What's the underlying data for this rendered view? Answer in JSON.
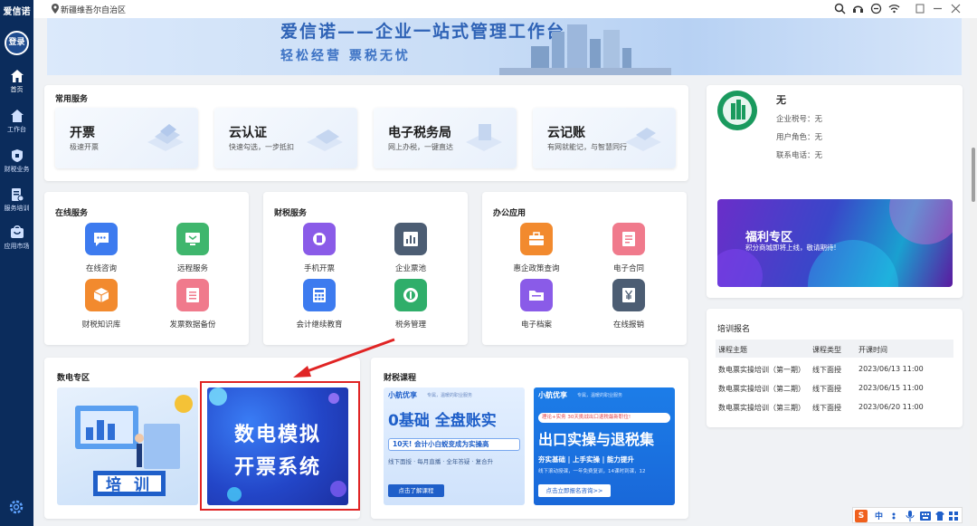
{
  "sidebar": {
    "brand": "爱信诺",
    "login": "登录",
    "items": [
      {
        "label": "首页",
        "icon": "home-icon"
      },
      {
        "label": "工作台",
        "icon": "workbench-icon"
      },
      {
        "label": "财税业务",
        "icon": "tax-business-icon"
      },
      {
        "label": "服务培训",
        "icon": "service-training-icon"
      },
      {
        "label": "应用市场",
        "icon": "app-market-icon"
      }
    ],
    "settings_icon": "gear-icon"
  },
  "topbar": {
    "location": "新疆维吾尔自治区",
    "icons": [
      "search-icon",
      "headset-icon",
      "minus-circle-icon",
      "wifi-icon",
      "restore-icon",
      "minimize-icon",
      "close-icon"
    ]
  },
  "banner": {
    "title": "爱信诺——企业一站式管理工作台",
    "subtitle": "轻松经营   票税无忧"
  },
  "common_services": {
    "title": "常用服务",
    "items": [
      {
        "title": "开票",
        "subtitle": "极速开票"
      },
      {
        "title": "云认证",
        "subtitle": "快速勾选，一步抵扣"
      },
      {
        "title": "电子税务局",
        "subtitle": "网上办税，一键直达"
      },
      {
        "title": "云记账",
        "subtitle": "有网就能记，与智慧同行"
      }
    ]
  },
  "online_services": {
    "title": "在线服务",
    "items": [
      {
        "label": "在线咨询",
        "color": "#3d7bef"
      },
      {
        "label": "远程服务",
        "color": "#3fb66d"
      },
      {
        "label": "财税知识库",
        "color": "#f28a2e"
      },
      {
        "label": "发票数据备份",
        "color": "#f07a8c"
      }
    ]
  },
  "tax_services": {
    "title": "财税服务",
    "items": [
      {
        "label": "手机开票",
        "color": "#8a5be8"
      },
      {
        "label": "企业票池",
        "color": "#4c5d73"
      },
      {
        "label": "会计继续教育",
        "color": "#3d7bef"
      },
      {
        "label": "税务管理",
        "color": "#2fae6a"
      }
    ]
  },
  "office_apps": {
    "title": "办公应用",
    "items": [
      {
        "label": "惠企政策查询",
        "color": "#f28a2e"
      },
      {
        "label": "电子合同",
        "color": "#f07a8c"
      },
      {
        "label": "电子档案",
        "color": "#8a5be8"
      },
      {
        "label": "在线报销",
        "color": "#4c5d73"
      }
    ]
  },
  "profile": {
    "name": "无",
    "tax_id": "企业税号：无",
    "role": "用户角色：无",
    "phone": "联系电话：无"
  },
  "welfare": {
    "title": "福利专区",
    "subtitle": "积分商城即将上线，敬请期待!"
  },
  "training": {
    "title": "培训报名",
    "headers": [
      "课程主题",
      "课程类型",
      "开课时间"
    ],
    "rows": [
      [
        "数电票实操培训（第一期）",
        "线下面授",
        "2023/06/13 11:00"
      ],
      [
        "数电票实操培训（第二期）",
        "线下面授",
        "2023/06/15 11:00"
      ],
      [
        "数电票实操培训（第三期）",
        "线下面授",
        "2023/06/20 11:00"
      ]
    ]
  },
  "digital_zone": {
    "title": "数电专区",
    "training_label": "培  训",
    "sim_title_1": "数电模拟",
    "sim_title_2": "开票系统"
  },
  "tax_courses": {
    "title": "财税课程",
    "course1": {
      "brand": "小航优享",
      "tag": "专属，温暖的职业服务",
      "headline": "0基础 全盘账实",
      "line1": "10天! 会计小白蜕变成为实操高",
      "line2": "线下面授 · 每月直播 · 全年答疑 · 复合升",
      "cta": "点击了解课程"
    },
    "course2": {
      "brand": "小航优享",
      "tag": "专属，温暖的职业服务",
      "pill": "理论+实务 30天挑战出口退税最新职位!",
      "headline": "出口实操与退税集",
      "line1": "夯实基础 | 上手实操 | 能力提升",
      "line2": "线下滚动授课，一年免费复训，14课时到课，12",
      "cta": "点击立即报名咨询>>"
    }
  },
  "ime": {
    "lang": "中"
  }
}
